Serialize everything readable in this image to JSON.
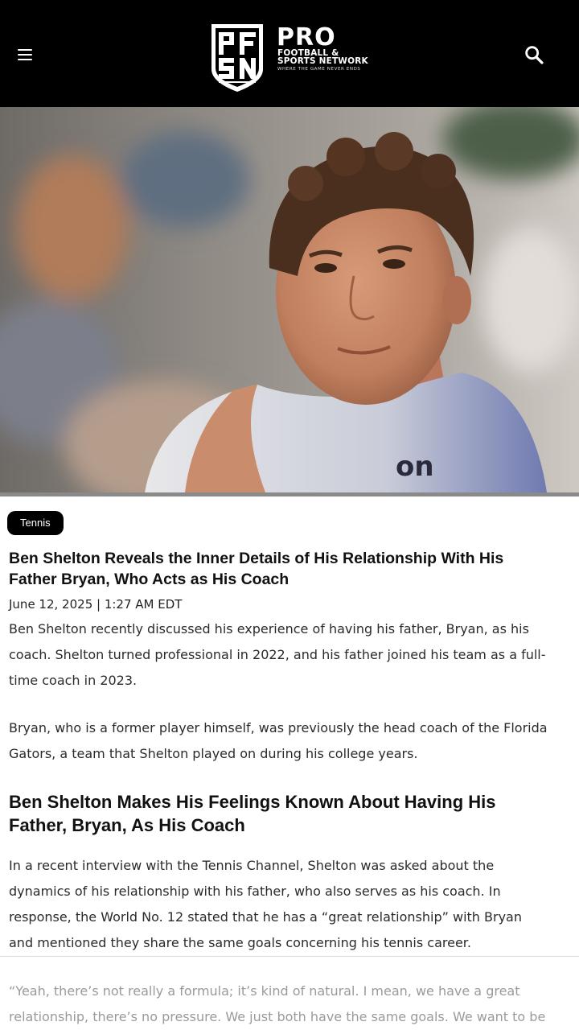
{
  "header": {
    "menu_icon": "hamburger-menu-icon",
    "search_icon": "search-icon",
    "logo": {
      "mark_letters": "PFSN",
      "brand": "PRO",
      "line1": "FOOTBALL &",
      "line2": "SPORTS NETWORK",
      "tagline": "WHERE THE GAME NEVER ENDS"
    }
  },
  "article": {
    "category": "Tennis",
    "title": "Ben Shelton Reveals the Inner Details of His Relationship With His Father Bryan, Who Acts as His Coach",
    "date": "June 12, 2025 | 1:27 AM EDT",
    "paragraphs": [
      "Ben Shelton recently discussed his experience of having his father, Bryan, as his coach. Shelton turned professional in 2022, and his father joined his team as a full-time coach in 2023.",
      "Bryan, who is a former player himself, was previously the head coach of the Florida Gators, a team that Shelton played on during his college years."
    ],
    "subheading": "Ben Shelton Makes His Feelings Known About Having His Father, Bryan, As His Coach",
    "paragraphs2": [
      "In a recent interview with the Tennis Channel, Shelton was asked about the dynamics of his relationship with his father, who also serves as his coach. In response, the World No. 12 stated that he has a “great relationship” with Bryan and mentioned they share the same goals concerning his tennis career.",
      "“Yeah, there’s not really a formula; it’s kind of natural. I mean, we have a great relationship, there’s no pressure. We just both have the same goals. We want to be"
    ]
  },
  "colors": {
    "header_bg": "#000000",
    "tag_bg": "#000000",
    "text": "#2a2a2a",
    "faded_text": "#9a9a9a"
  }
}
